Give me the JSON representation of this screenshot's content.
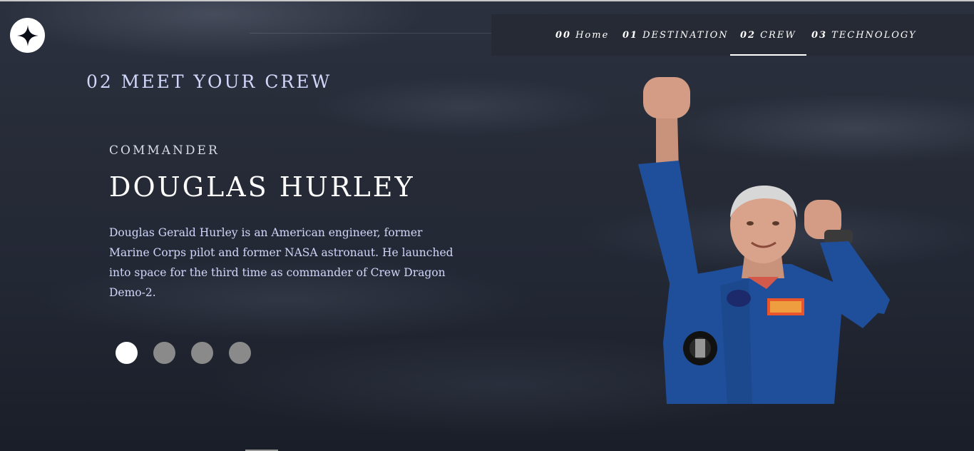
{
  "logo": {
    "icon": "star-icon"
  },
  "nav": {
    "items": [
      {
        "num": "00",
        "label": "Home",
        "active": false
      },
      {
        "num": "01",
        "label": "DESTINATION",
        "active": false
      },
      {
        "num": "02",
        "label": "CREW",
        "active": true
      },
      {
        "num": "03",
        "label": "TECHNOLOGY",
        "active": false
      }
    ]
  },
  "page": {
    "heading": "02 MEET YOUR CREW"
  },
  "crew": {
    "role": "COMMANDER",
    "name": "DOUGLAS HURLEY",
    "bio": "Douglas Gerald Hurley is an American engineer, former Marine Corps pilot and former NASA astronaut. He launched into space for the third time as commander of Crew Dragon Demo-2.",
    "dots": [
      {
        "active": true
      },
      {
        "active": false
      },
      {
        "active": false
      },
      {
        "active": false
      }
    ],
    "image": {
      "icon": "astronaut-photo",
      "suit_color": "#1f4f9a"
    }
  },
  "colors": {
    "accent_text": "#d0d6f9",
    "inactive_dot": "#8a8a8a",
    "nav_bg": "#262a34"
  }
}
